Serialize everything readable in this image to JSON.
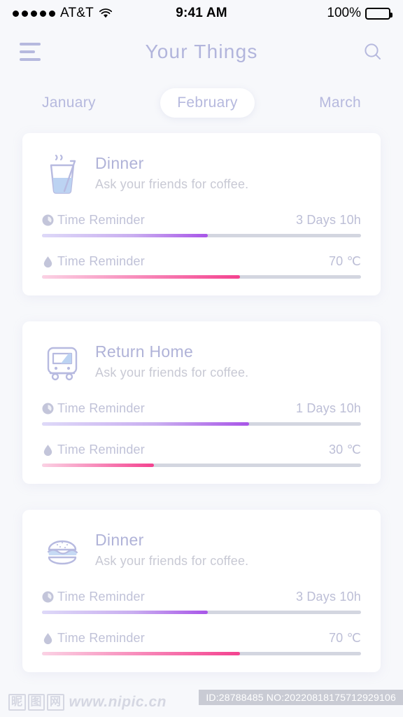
{
  "status_bar": {
    "signal_dots": 5,
    "carrier": "AT&T",
    "wifi_icon": "wifi-icon",
    "time": "9:41 AM",
    "battery_percent": "100%",
    "battery_icon": "battery-full-icon"
  },
  "header": {
    "menu_icon": "hamburger-menu-icon",
    "title": "Your Things",
    "search_icon": "search-icon",
    "title_color": "#b2b5dc"
  },
  "month_tabs": [
    {
      "label": "January",
      "active": false
    },
    {
      "label": "February",
      "active": true
    },
    {
      "label": "March",
      "active": false
    }
  ],
  "colors": {
    "background": "#f7f8fb",
    "card": "#ffffff",
    "accent_purple": "#a855e8",
    "accent_pink": "#f4428f",
    "track": "#d3d6e0",
    "title_text": "#b0b3d8",
    "subtitle_text": "#c8c9d4"
  },
  "cards": [
    {
      "icon": "drink-glass-icon",
      "title": "Dinner",
      "subtitle": "Ask your friends for coffee.",
      "metrics": [
        {
          "icon": "clock-icon",
          "label": "Time Reminder",
          "value": "3 Days 10h",
          "percent": 52,
          "color": "purple"
        },
        {
          "icon": "water-drop-icon",
          "label": "Time Reminder",
          "value": "70 ℃",
          "percent": 62,
          "color": "pink"
        }
      ]
    },
    {
      "icon": "tram-icon",
      "title": "Return Home",
      "subtitle": "Ask your friends for coffee.",
      "metrics": [
        {
          "icon": "clock-icon",
          "label": "Time Reminder",
          "value": "1 Days 10h",
          "percent": 65,
          "color": "purple"
        },
        {
          "icon": "water-drop-icon",
          "label": "Time Reminder",
          "value": "30 ℃",
          "percent": 35,
          "color": "pink"
        }
      ]
    },
    {
      "icon": "hamburger-food-icon",
      "title": "Dinner",
      "subtitle": "Ask your friends for coffee.",
      "metrics": [
        {
          "icon": "clock-icon",
          "label": "Time Reminder",
          "value": "3 Days 10h",
          "percent": 52,
          "color": "purple"
        },
        {
          "icon": "water-drop-icon",
          "label": "Time Reminder",
          "value": "70 ℃",
          "percent": 62,
          "color": "pink"
        }
      ]
    }
  ],
  "watermark": {
    "site": "www.nipic.cn",
    "cn_chars": [
      "昵",
      "图",
      "网"
    ],
    "id_text": "ID:28788485 NO:20220818175712929106"
  }
}
